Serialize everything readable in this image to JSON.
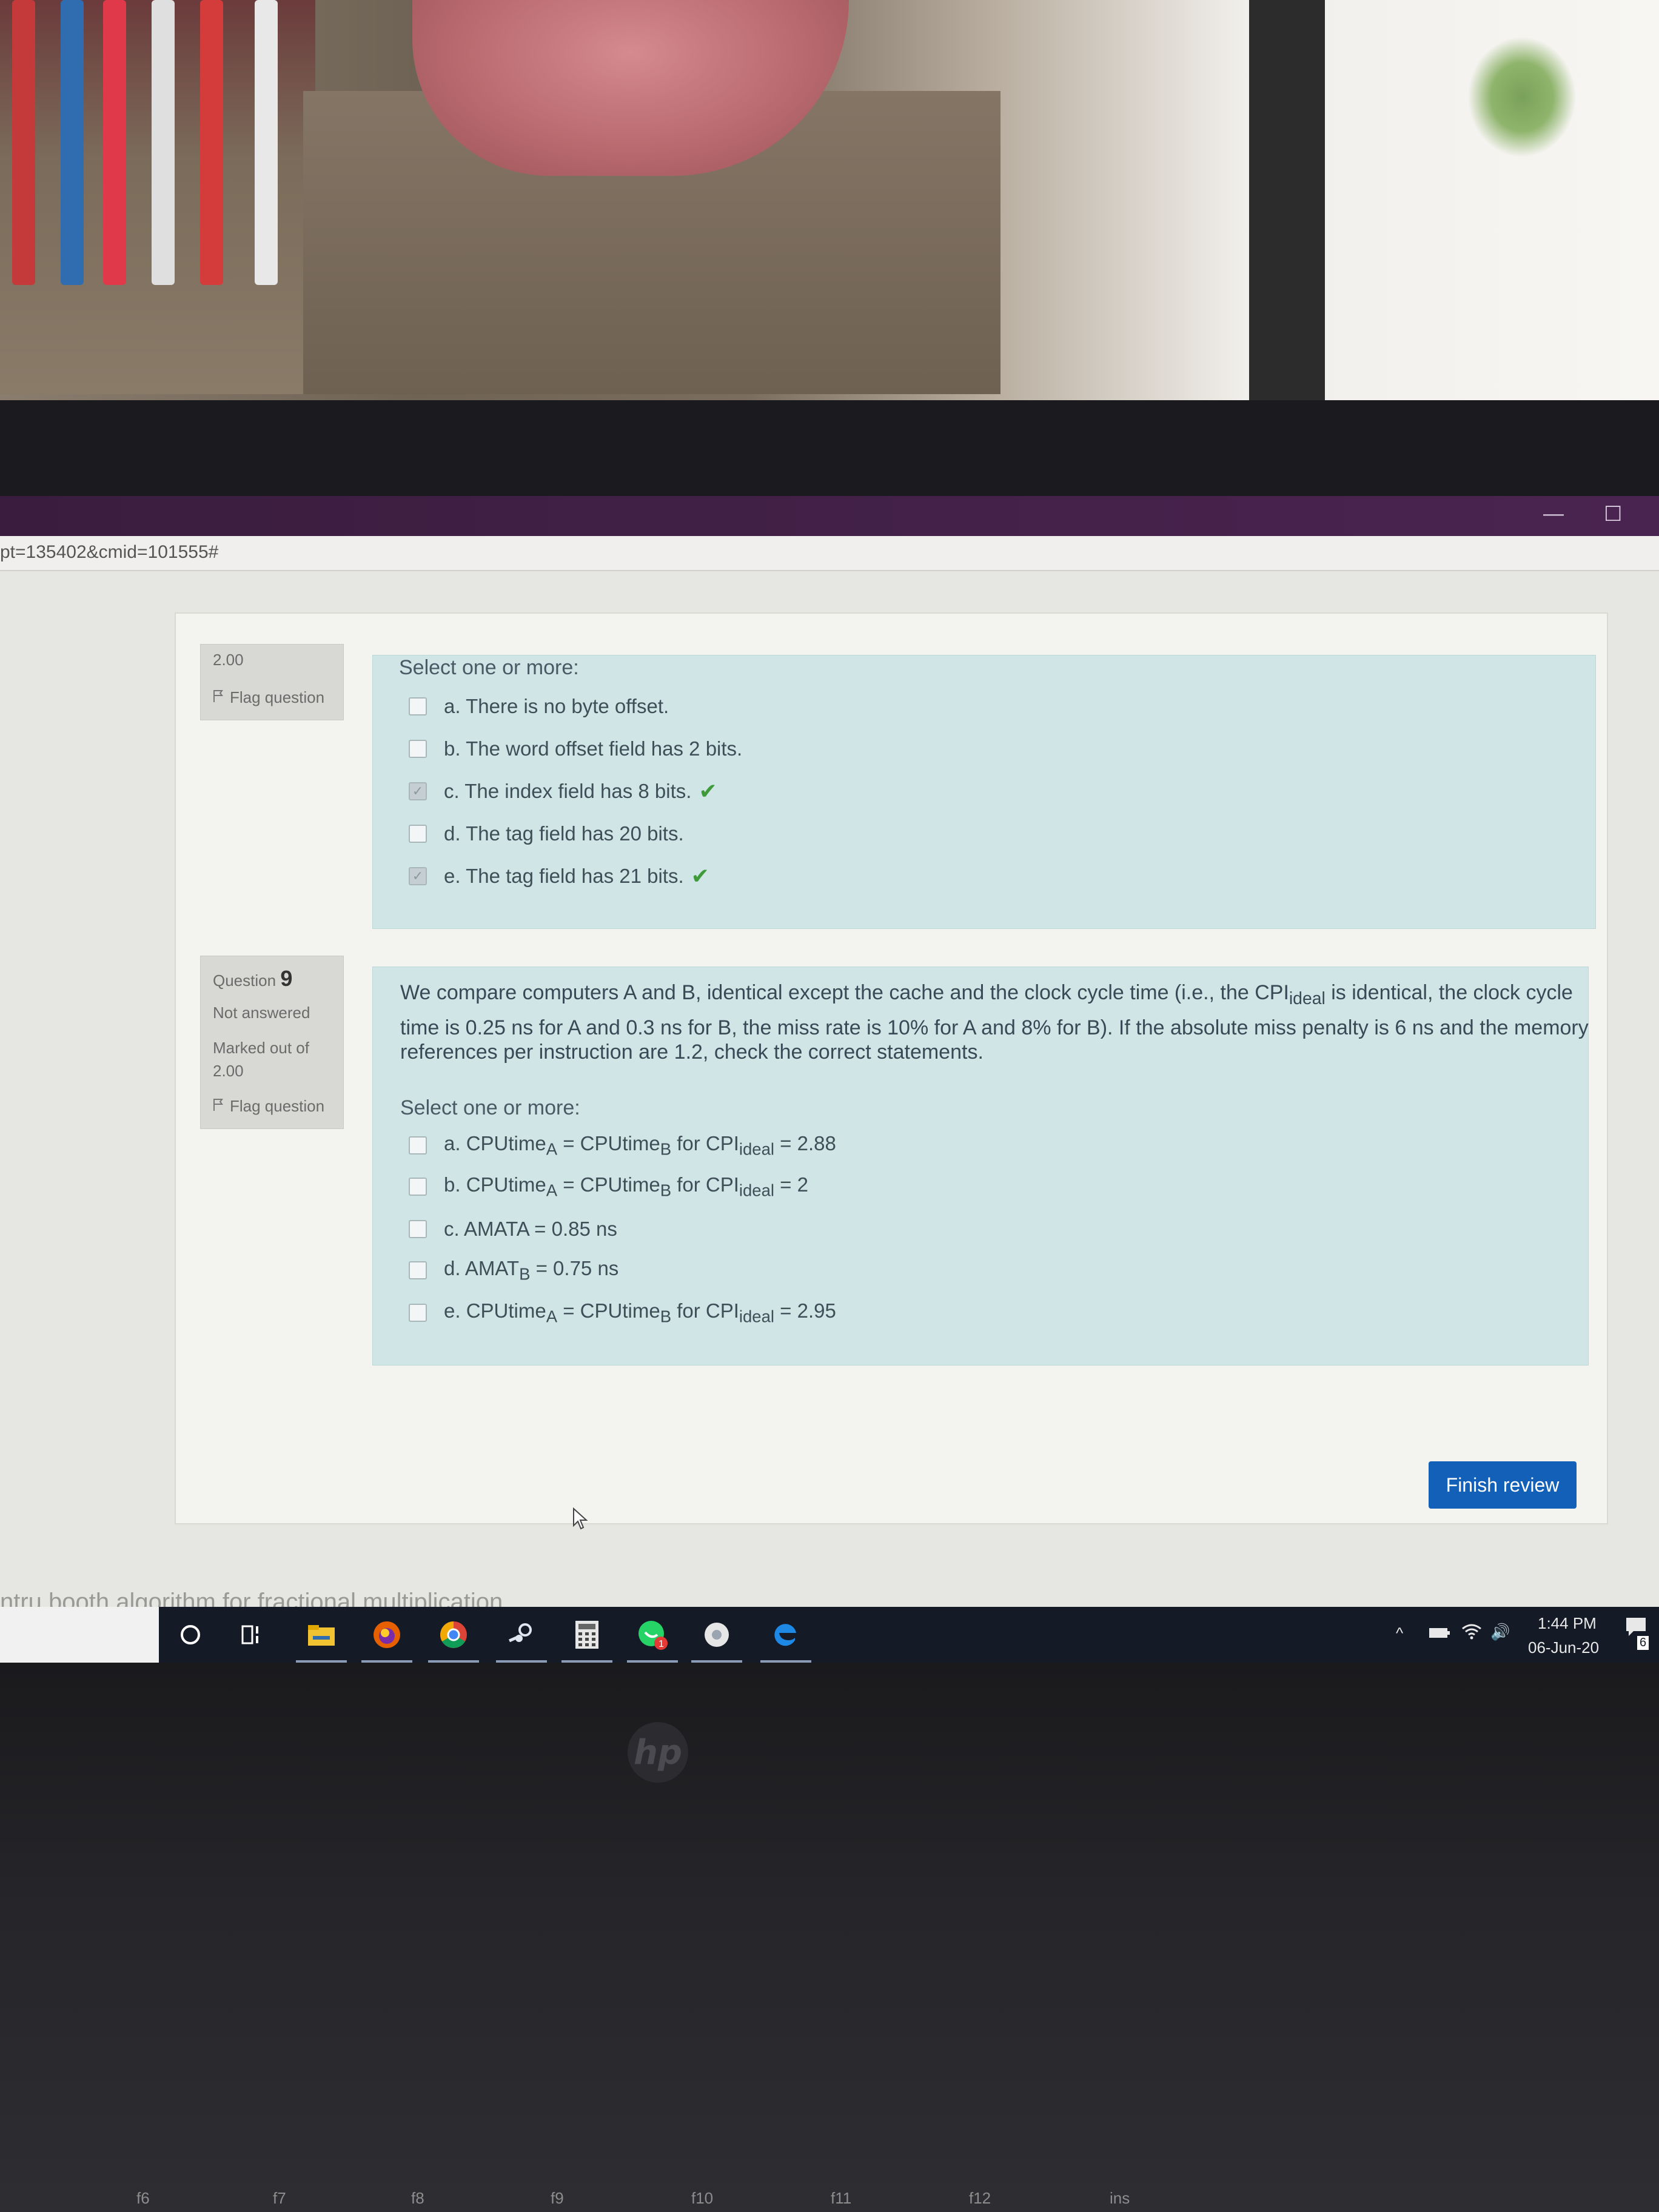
{
  "browser": {
    "url_fragment": "pt=135402&cmid=101555#",
    "minimize_glyph": "—",
    "maximize_glyph": "☐"
  },
  "question8": {
    "marked_value": "2.00",
    "flag_label": "Flag question",
    "prompt": "Select one or more:",
    "options": [
      {
        "label": "a. There is no byte offset.",
        "checked": false,
        "correct_mark": false
      },
      {
        "label": "b. The word offset field has 2 bits.",
        "checked": false,
        "correct_mark": false
      },
      {
        "label": "c. The index field has 8 bits.",
        "checked": true,
        "correct_mark": true
      },
      {
        "label": "d. The tag field has 20 bits.",
        "checked": false,
        "correct_mark": false
      },
      {
        "label": "e. The tag field has 21 bits.",
        "checked": true,
        "correct_mark": true
      }
    ]
  },
  "question9": {
    "label": "Question",
    "number": "9",
    "status": "Not answered",
    "marked_out_of": "Marked out of",
    "marked_value": "2.00",
    "flag_label": "Flag question",
    "text_line1_a": "We compare computers A and B, identical except the cache and the clock cycle time (i.e., the CPI",
    "text_line1_sub": "ideal",
    "text_line1_b": " is identical, the clock cycle",
    "text_line2": "time is 0.25 ns for A and 0.3 ns for B, the miss rate is 10% for A and 8% for B). If the absolute miss penalty is 6 ns and the memory",
    "text_line3": "references per instruction are 1.2, check the correct statements.",
    "prompt": "Select one or more:",
    "options": {
      "a": {
        "p1": "a. CPUtime",
        "s1": "A",
        "p2": " = CPUtime",
        "s2": "B",
        "p3": " for CPI",
        "s3": "ideal",
        "p4": " = 2.88"
      },
      "b": {
        "p1": "b. CPUtime",
        "s1": "A",
        "p2": " = CPUtime",
        "s2": "B",
        "p3": " for CPI",
        "s3": "ideal",
        "p4": " = 2"
      },
      "c": {
        "p1": "c. AMATA = 0.85 ns"
      },
      "d": {
        "p1": "d. AMAT",
        "s1": "B",
        "p2": " = 0.75 ns"
      },
      "e": {
        "p1": "e. CPUtime",
        "s1": "A",
        "p2": " = CPUtime",
        "s2": "B",
        "p3": " for CPI",
        "s3": "ideal",
        "p4": " = 2.95"
      }
    }
  },
  "finish_button": "Finish review",
  "background_text": "ntru booth algorithm for fractional multiplication",
  "taskbar": {
    "time": "1:44 PM",
    "date": "06-Jun-20",
    "notification_count": "6",
    "whatsapp_badge": "1",
    "tray_chevron": "^",
    "volume_glyph": "🔊"
  },
  "laptop": {
    "logo": "hp",
    "keys": [
      "f6",
      "f7",
      "f8",
      "f9",
      "f10",
      "f11",
      "f12",
      "ins"
    ]
  },
  "colors": {
    "titlebar": "#3a1d3e",
    "formulation_bg": "#cfe5e6",
    "finish_button": "#1260b8",
    "correct_tick": "#3f9a3a"
  }
}
